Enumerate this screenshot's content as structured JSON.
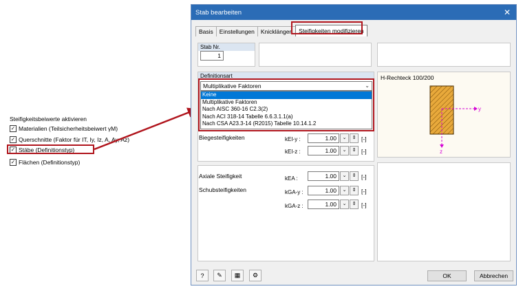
{
  "left": {
    "title": "Steifigkeitsbeiwerte aktivieren",
    "items": [
      {
        "label": "Materialien (Teilsicherheitsbeiwert γM)",
        "checked": true
      },
      {
        "label": "Querschnitte (Faktor für IT, Iy, Iz, A, Ay, Az)",
        "checked": true
      },
      {
        "label": "Stäbe (Definitionstyp)",
        "checked": true
      },
      {
        "label": "Flächen (Definitionstyp)",
        "checked": true
      }
    ]
  },
  "dialog": {
    "title": "Stab bearbeiten",
    "close": "✕",
    "tabs": [
      "Basis",
      "Einstellungen",
      "Knicklängen",
      "Steifigkeiten modifizieren"
    ],
    "stab_nr_label": "Stab Nr.",
    "stab_nr_value": "1",
    "definitionsart_label": "Definitionsart",
    "combo_value": "Multiplikative Faktoren",
    "dropdown_options": [
      "Keine",
      "Multiplikative Faktoren",
      "Nach AISC 360-16 C2.3(2)",
      "Nach ACI 318-14 Tabelle 6.6.3.1.1(a)",
      "Nach CSA A23.3-14 (R2015) Tabelle 10.14.1.2"
    ],
    "section_title": "H-Rechteck 100/200",
    "axis_y": "y",
    "axis_z": "z",
    "props": [
      {
        "group": "Biegesteifigkeiten",
        "symbol": "kEI-y :",
        "value": "1.00",
        "unit": "[-]"
      },
      {
        "group": "",
        "symbol": "kEI-z :",
        "value": "1.00",
        "unit": "[-]"
      },
      {
        "group": "Axiale Steifigkeit",
        "symbol": "kEA :",
        "value": "1.00",
        "unit": "[-]"
      },
      {
        "group": "Schubsteifigkeiten",
        "symbol": "kGA-y :",
        "value": "1.00",
        "unit": "[-]"
      },
      {
        "group": "",
        "symbol": "kGA-z :",
        "value": "1.00",
        "unit": "[-]"
      }
    ],
    "ok": "OK",
    "cancel": "Abbrechen",
    "bottom_icons": [
      "help-icon",
      "edit-icon",
      "table-icon",
      "calculate-icon"
    ]
  },
  "colors": {
    "titlebar": "#2b6cb6",
    "highlight": "#b0141c",
    "selection": "#0078d7",
    "section_fill": "#e8a93b"
  }
}
